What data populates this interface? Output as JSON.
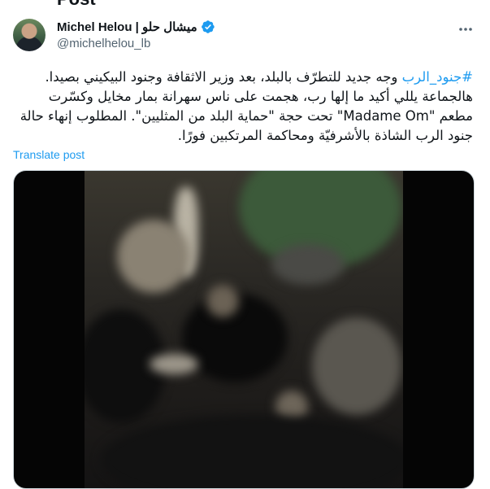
{
  "header": {
    "title": "Post"
  },
  "author": {
    "name": "Michel Helou | ميشال حلو",
    "handle": "@michelhelou_lb"
  },
  "tweet": {
    "hashtag": "#جنود_الرب",
    "text_part1": " وجه جديد للتطرّف بالبلد، بعد وزير الاثقافة وجنود البيكيني بصيدا.",
    "text_part2": "هالجماعة يللي أكيد ما إلها رب، هجمت على ناس سهرانة بمار مخايل وكسّرت مطعم \"Madame Om\" تحت حجة \"حماية البلد من المثليين\". المطلوب إنهاء حالة جنود الرب الشاذة بالأشرفيّة ومحاكمة المرتكبين فورًا."
  },
  "translate_label": "Translate post",
  "colors": {
    "accent": "#1d9bf0",
    "muted": "#536471",
    "text": "#0f1419"
  },
  "icons": {
    "verified": "verified-badge-icon",
    "more": "more-icon"
  }
}
